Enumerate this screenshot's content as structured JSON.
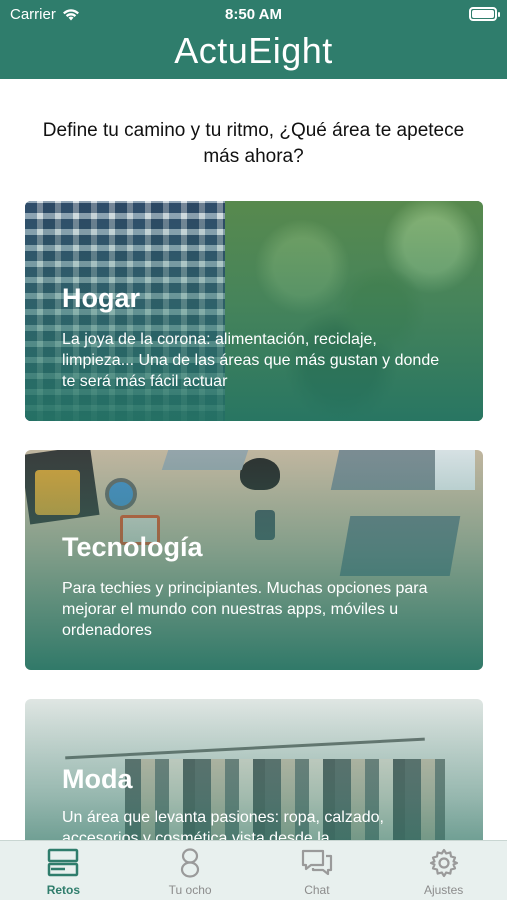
{
  "status_bar": {
    "carrier": "Carrier",
    "time": "8:50 AM"
  },
  "header": {
    "title": "ActuEight"
  },
  "intro_text": "Define tu camino y tu ritmo, ¿Qué área te apetece más ahora?",
  "cards": [
    {
      "title": "Hogar",
      "description": "La joya de la corona: alimentación, reciclaje, limpieza... Una de las áreas que más gustan y donde te será más fácil actuar"
    },
    {
      "title": "Tecnología",
      "description": "Para techies y principiantes. Muchas opciones para mejorar el mundo con nuestras apps, móviles u ordenadores"
    },
    {
      "title": "Moda",
      "description": "Un área que levanta pasiones: ropa, calzado, accesorios y cosmética vista desde la"
    }
  ],
  "tab_bar": {
    "tabs": [
      {
        "label": "Retos",
        "icon": "challenges-icon",
        "active": true
      },
      {
        "label": "Tu ocho",
        "icon": "eight-icon",
        "active": false
      },
      {
        "label": "Chat",
        "icon": "chat-icon",
        "active": false
      },
      {
        "label": "Ajustes",
        "icon": "gear-icon",
        "active": false
      }
    ]
  },
  "colors": {
    "brand": "#2f7d6c",
    "tab_inactive": "#8c8c8c",
    "tab_bar_bg": "#e8f0ee"
  }
}
